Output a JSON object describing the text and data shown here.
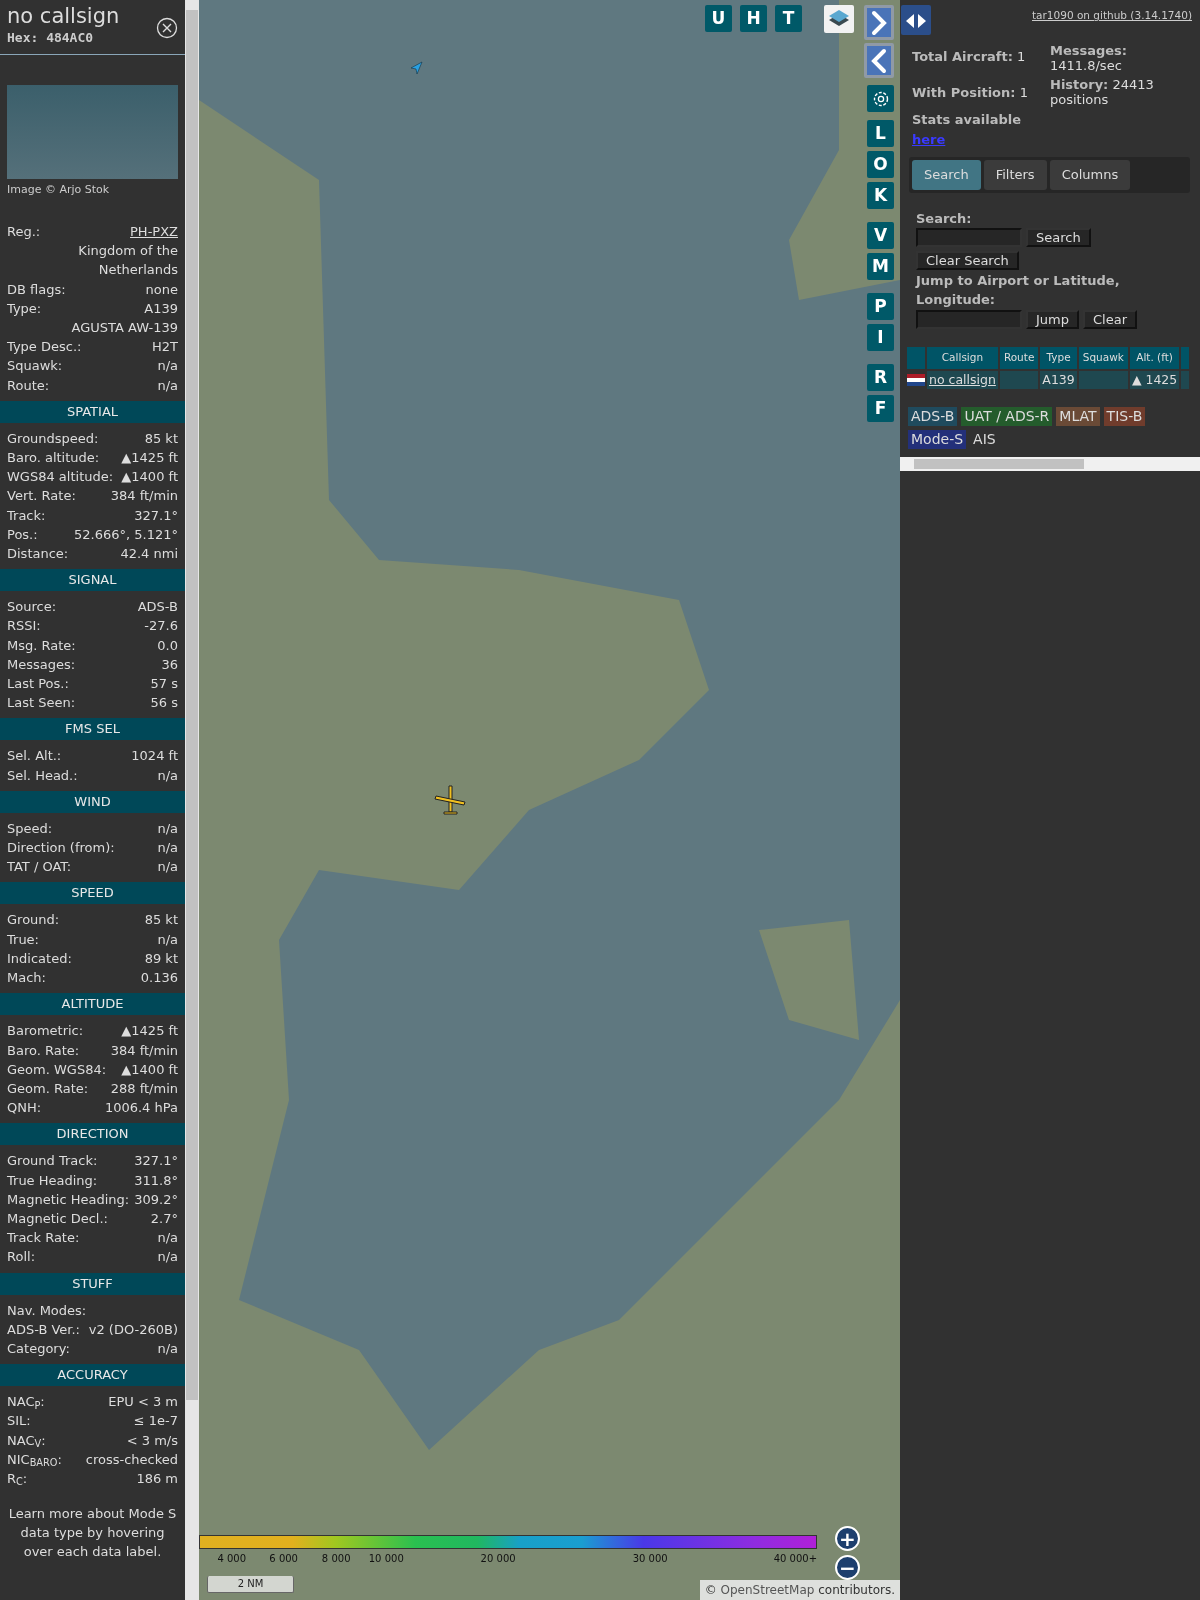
{
  "sidebar": {
    "title": "no callsign",
    "hex": "Hex: 484AC0",
    "photo_credit": "Image © Arjo Stok",
    "details": [
      {
        "label": "Reg.:",
        "value": "PH-PXZ",
        "kind": "link"
      },
      {
        "value": "Kingdom of the Netherlands",
        "kind": "text"
      },
      {
        "label": "DB flags:",
        "value": "none",
        "kind": "text"
      },
      {
        "label": "Type:",
        "value": "A139",
        "kind": "text"
      },
      {
        "value": "AGUSTA AW-139",
        "kind": "text"
      },
      {
        "label": "Type Desc.:",
        "value": "H2T",
        "kind": "text"
      },
      {
        "label": "Squawk:",
        "value": "n/a",
        "kind": "text"
      },
      {
        "label": "Route:",
        "value": "n/a",
        "kind": "text"
      }
    ],
    "sections": [
      {
        "title": "SPATIAL",
        "rows": [
          {
            "label": "Groundspeed:",
            "value": "85 kt"
          },
          {
            "label": "Baro. altitude:",
            "value": "▲1425 ft"
          },
          {
            "label": "WGS84 altitude:",
            "value": "▲1400 ft"
          },
          {
            "label": "Vert. Rate:",
            "value": "384 ft/min"
          },
          {
            "label": "Track:",
            "value": "327.1°"
          },
          {
            "label": "Pos.:",
            "value": "52.666°, 5.121°"
          },
          {
            "label": "Distance:",
            "value": "42.4 nmi"
          }
        ]
      },
      {
        "title": "SIGNAL",
        "rows": [
          {
            "label": "Source:",
            "value": "ADS-B"
          },
          {
            "label": "RSSI:",
            "value": "-27.6"
          },
          {
            "label": "Msg. Rate:",
            "value": "0.0"
          },
          {
            "label": "Messages:",
            "value": "36"
          },
          {
            "label": "Last Pos.:",
            "value": "57 s"
          },
          {
            "label": "Last Seen:",
            "value": "56 s"
          }
        ]
      },
      {
        "title": "FMS SEL",
        "rows": [
          {
            "label": "Sel. Alt.:",
            "value": "1024 ft"
          },
          {
            "label": "Sel. Head.:",
            "value": "n/a"
          }
        ]
      },
      {
        "title": "WIND",
        "rows": [
          {
            "label": "Speed:",
            "value": "n/a"
          },
          {
            "label": "Direction (from):",
            "value": "n/a"
          },
          {
            "label": "TAT / OAT:",
            "value": "n/a"
          }
        ]
      },
      {
        "title": "SPEED",
        "rows": [
          {
            "label": "Ground:",
            "value": "85 kt"
          },
          {
            "label": "True:",
            "value": "n/a"
          },
          {
            "label": "Indicated:",
            "value": "89 kt"
          },
          {
            "label": "Mach:",
            "value": "0.136"
          }
        ]
      },
      {
        "title": "ALTITUDE",
        "rows": [
          {
            "label": "Barometric:",
            "value": "▲1425 ft"
          },
          {
            "label": "Baro. Rate:",
            "value": "384 ft/min"
          },
          {
            "label": "Geom. WGS84:",
            "value": "▲1400 ft"
          },
          {
            "label": "Geom. Rate:",
            "value": "288 ft/min"
          },
          {
            "label": "QNH:",
            "value": "1006.4 hPa"
          }
        ]
      },
      {
        "title": "DIRECTION",
        "rows": [
          {
            "label": "Ground Track:",
            "value": "327.1°"
          },
          {
            "label": "True Heading:",
            "value": "311.8°"
          },
          {
            "label": "Magnetic Heading:",
            "value": "309.2°"
          },
          {
            "label": "Magnetic Decl.:",
            "value": "2.7°"
          },
          {
            "label": "Track Rate:",
            "value": "n/a"
          },
          {
            "label": "Roll:",
            "value": "n/a"
          }
        ]
      },
      {
        "title": "STUFF",
        "rows": [
          {
            "label": "Nav. Modes:"
          },
          {
            "label": "ADS-B Ver.:",
            "value": "v2 (DO-260B)"
          },
          {
            "label": "Category:",
            "value": "n/a"
          }
        ]
      },
      {
        "title": "ACCURACY",
        "rows": [
          {
            "label": "NAC$_{P}$:",
            "value": "EPU < 3 m"
          },
          {
            "label": "SIL:",
            "value": "≤ 1e-7"
          },
          {
            "label": "NAC$_{V}$:",
            "value": "< 3 m/s"
          },
          {
            "label": "NIC$_{BARO}$:",
            "value": "cross-checked"
          },
          {
            "label": "R$_{C}$:",
            "value": "186 m"
          }
        ]
      }
    ],
    "note": "Learn more about Mode S data type by hovering over each data label."
  },
  "map": {
    "top_buttons": [
      "U",
      "H",
      "T"
    ],
    "side_groups": [
      [
        "L",
        "O",
        "K"
      ],
      [
        "V",
        "M"
      ],
      [
        "P",
        "I"
      ],
      [
        "R",
        "F"
      ]
    ],
    "legend": [
      "4 000",
      "6 000",
      "8 000",
      "10 000",
      "20 000",
      "30 000",
      "40 000+"
    ],
    "scale": "2 NM",
    "zoom_buttons": [
      "+",
      "−"
    ],
    "attribution": {
      "prefix": "©",
      "link": "OpenStreetMap",
      "suffix": "contributors."
    }
  },
  "panel": {
    "github_link": "tar1090 on github (3.14.1740)",
    "stats": [
      {
        "label": "Total Aircraft:",
        "value": "1"
      },
      {
        "label": "With Position:",
        "value": "1"
      }
    ],
    "stats_link_label": "Stats available",
    "stats_link": "here",
    "stats_right": [
      "**Messages:** 1411.8/sec",
      "**History:** 24413 positions"
    ],
    "tabs": [
      {
        "label": "Search",
        "selected": true
      },
      {
        "label": "Filters",
        "selected": false
      },
      {
        "label": "Columns",
        "selected": false
      }
    ],
    "search_label": "Search:",
    "search_button": "Search",
    "clear_search_button": "Clear Search",
    "jump_label": "Jump to Airport or Latitude, Longitude:",
    "jump_button": "Jump",
    "clear_button": "Clear",
    "table": {
      "columns": [
        "Callsign",
        "Route",
        "Type",
        "Squawk",
        "Alt. (ft)"
      ],
      "rows": [
        {
          "callsign": "no callsign",
          "type": "A139",
          "altitude": "▲ 1425"
        }
      ]
    },
    "sources": [
      {
        "label": "ADS-B",
        "color": "#1f4b5e"
      },
      {
        "label": "UAT / ADS-R",
        "color": "#245c2c"
      },
      {
        "label": "MLAT",
        "color": "#6a4a36"
      },
      {
        "label": "TIS-B",
        "color": "#703c2c"
      },
      {
        "label": "Mode-S",
        "color": "#23307a"
      },
      {
        "label": "AIS"
      }
    ]
  }
}
